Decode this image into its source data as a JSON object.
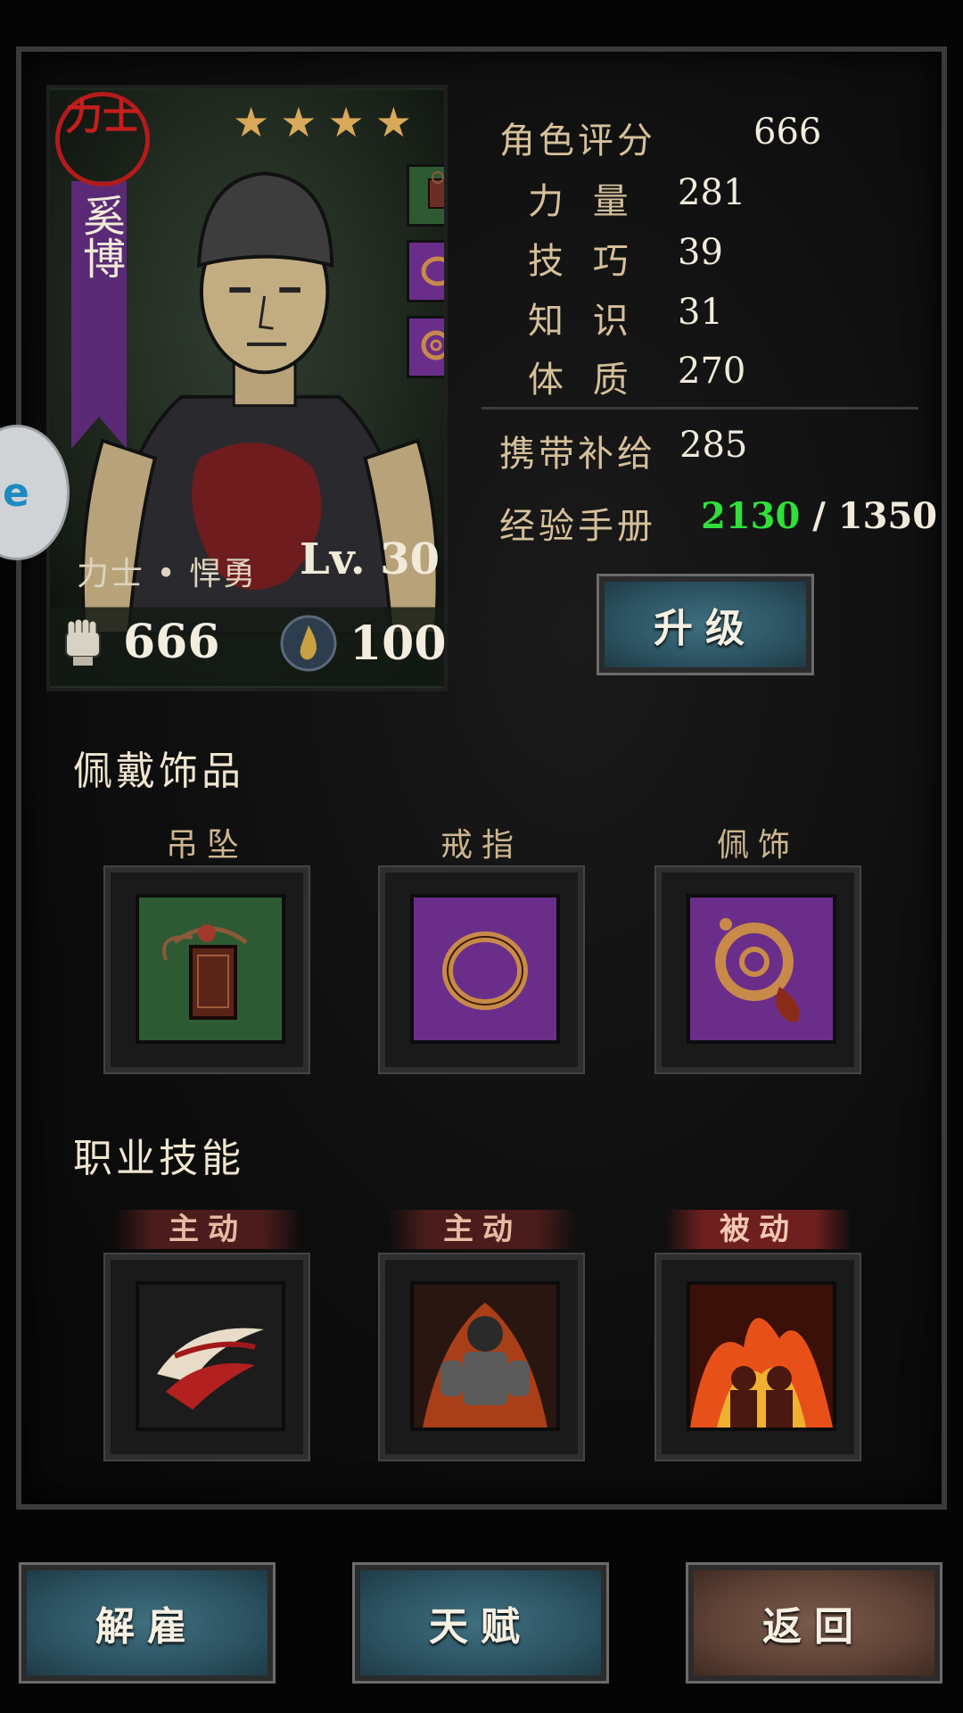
{
  "hero": {
    "rank_seal": "力士",
    "name": "奚博",
    "stars": 4,
    "class_line": "力士 • 悍勇",
    "level_prefix": "Lv.",
    "level": "30",
    "power": "666",
    "stress": "100",
    "mini_equipment": [
      "pendant-icon",
      "ring-icon",
      "accessory-icon"
    ]
  },
  "stats": {
    "rating_label": "角色评分",
    "rating_value": "666",
    "strength_label": "力 量",
    "strength_value": "281",
    "skill_label": "技 巧",
    "skill_value": "39",
    "knowledge_label": "知 识",
    "knowledge_value": "31",
    "constitution_label": "体 质",
    "constitution_value": "270",
    "supply_label": "携带补给",
    "supply_value": "285",
    "exp_label": "经验手册",
    "exp_current": "2130",
    "exp_separator": " / ",
    "exp_required": "1350",
    "upgrade_button": "升级"
  },
  "accessories": {
    "title": "佩戴饰品",
    "slots": [
      {
        "label": "吊坠",
        "icon": "pendant-icon",
        "rarity_color": "#2d5a32"
      },
      {
        "label": "戒指",
        "icon": "ring-icon",
        "rarity_color": "#6a2e8a"
      },
      {
        "label": "佩饰",
        "icon": "accessory-icon",
        "rarity_color": "#6a2e8a"
      }
    ]
  },
  "skills": {
    "title": "职业技能",
    "slots": [
      {
        "tag": "主动",
        "icon": "whirlwind-skill-icon"
      },
      {
        "tag": "主动",
        "icon": "rage-skill-icon"
      },
      {
        "tag": "被动",
        "icon": "fire-aura-skill-icon"
      }
    ]
  },
  "footer": {
    "dismiss_button": "解雇",
    "talent_button": "天赋",
    "back_button": "返回"
  },
  "side_widget": {
    "text": "e"
  },
  "colors": {
    "exp_current": "#2fe03a",
    "label_gold": "#d6c09a",
    "button_blue": "#2c5362",
    "button_brown": "#5f4236"
  }
}
